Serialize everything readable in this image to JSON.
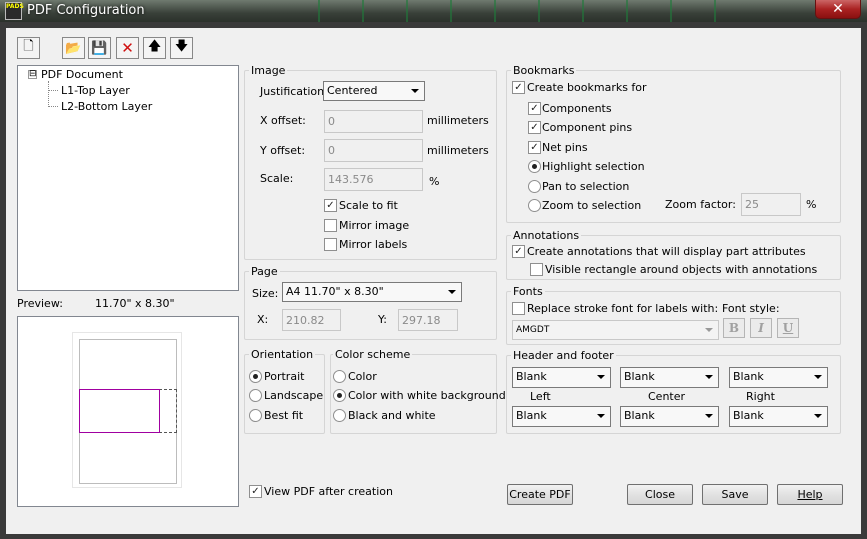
{
  "window": {
    "title": "PDF Configuration",
    "close": "✕",
    "icon_text": "PADS"
  },
  "tree": {
    "root": "PDF Document",
    "expander": "⊟",
    "children": [
      "L1-Top Layer",
      "L2-Bottom Layer"
    ]
  },
  "preview": {
    "label": "Preview:",
    "size": "11.70\" x  8.30\""
  },
  "image": {
    "title": "Image",
    "justification_label": "Justification:",
    "justification_value": "Centered",
    "xoffset_label": "X offset:",
    "xoffset_value": "0",
    "yoffset_label": "Y offset:",
    "yoffset_value": "0",
    "units": "millimeters",
    "scale_label": "Scale:",
    "scale_value": "143.576",
    "percent": "%",
    "scale_to_fit": "Scale to fit",
    "mirror_image": "Mirror image",
    "mirror_labels": "Mirror labels"
  },
  "page": {
    "title": "Page",
    "size_label": "Size:",
    "size_value": "A4   11.70\" x  8.30\"",
    "x_label": "X:",
    "x_value": "210.82",
    "y_label": "Y:",
    "y_value": "297.18"
  },
  "orientation": {
    "title": "Orientation",
    "options": [
      "Portrait",
      "Landscape",
      "Best fit"
    ]
  },
  "color_scheme": {
    "title": "Color scheme",
    "options": [
      "Color",
      "Color with white background",
      "Black and white"
    ]
  },
  "bookmarks": {
    "title": "Bookmarks",
    "create": "Create bookmarks for",
    "components": "Components",
    "component_pins": "Component pins",
    "net_pins": "Net pins",
    "highlight": "Highlight selection",
    "pan": "Pan to selection",
    "zoom": "Zoom to selection",
    "zoom_factor_label": "Zoom factor:",
    "zoom_factor_value": "25",
    "percent": "%"
  },
  "annotations": {
    "title": "Annotations",
    "create": "Create annotations that will display part attributes",
    "visible_rect": "Visible rectangle around objects with annotations"
  },
  "fonts": {
    "title": "Fonts",
    "replace_stroke": "Replace stroke font for labels with:",
    "font_style_label": "Font style:",
    "font_value": "AMGDT",
    "bold": "B",
    "italic": "I",
    "underline": "U"
  },
  "header_footer": {
    "title": "Header and footer",
    "top": [
      "Blank",
      "Blank",
      "Blank"
    ],
    "labels": [
      "Left",
      "Center",
      "Right"
    ],
    "bottom": [
      "Blank",
      "Blank",
      "Blank"
    ]
  },
  "view_pdf": "View PDF after creation",
  "buttons": {
    "create_pdf": "Create PDF",
    "close": "Close",
    "save": "Save",
    "help": "Help"
  },
  "toolbar": {
    "new": "🗋",
    "open": "📂",
    "save": "💾",
    "delete": "✕",
    "up": "🡅",
    "down": "🡇"
  },
  "colors": {
    "delete": "#d01010",
    "checked_mark": "#1a1a1a",
    "preview_mark": "#a000a0"
  }
}
